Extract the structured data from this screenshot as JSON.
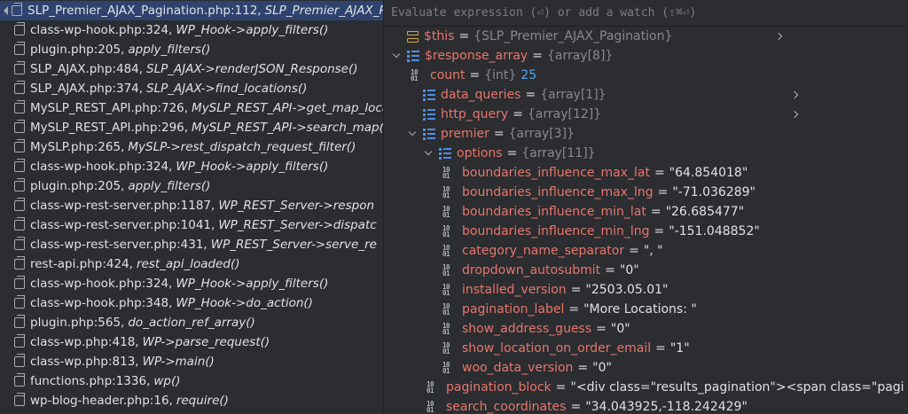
{
  "frames": [
    {
      "file": "SLP_Premier_AJAX_Pagination.php:112,",
      "method": "SLP_Premier_AJAX_P",
      "selected": true
    },
    {
      "file": "class-wp-hook.php:324,",
      "method": "WP_Hook->apply_filters()"
    },
    {
      "file": "plugin.php:205,",
      "method": "apply_filters()"
    },
    {
      "file": "SLP_AJAX.php:484,",
      "method": "SLP_AJAX->renderJSON_Response()"
    },
    {
      "file": "SLP_AJAX.php:374,",
      "method": "SLP_AJAX->find_locations()"
    },
    {
      "file": "MySLP_REST_API.php:726,",
      "method": "MySLP_REST_API->get_map_loca"
    },
    {
      "file": "MySLP_REST_API.php:296,",
      "method": "MySLP_REST_API->search_map()"
    },
    {
      "file": "MySLP.php:265,",
      "method": "MySLP->rest_dispatch_request_filter()"
    },
    {
      "file": "class-wp-hook.php:324,",
      "method": "WP_Hook->apply_filters()"
    },
    {
      "file": "plugin.php:205,",
      "method": "apply_filters()"
    },
    {
      "file": "class-wp-rest-server.php:1187,",
      "method": "WP_REST_Server->respon"
    },
    {
      "file": "class-wp-rest-server.php:1041,",
      "method": "WP_REST_Server->dispatc"
    },
    {
      "file": "class-wp-rest-server.php:431,",
      "method": "WP_REST_Server->serve_re"
    },
    {
      "file": "rest-api.php:424,",
      "method": "rest_api_loaded()"
    },
    {
      "file": "class-wp-hook.php:324,",
      "method": "WP_Hook->apply_filters()"
    },
    {
      "file": "class-wp-hook.php:348,",
      "method": "WP_Hook->do_action()"
    },
    {
      "file": "plugin.php:565,",
      "method": "do_action_ref_array()"
    },
    {
      "file": "class-wp.php:418,",
      "method": "WP->parse_request()"
    },
    {
      "file": "class-wp.php:813,",
      "method": "WP->main()"
    },
    {
      "file": "functions.php:1336,",
      "method": "wp()"
    },
    {
      "file": "wp-blog-header.php:16,",
      "method": "require()"
    }
  ],
  "evaluate": {
    "placeholder": "Evaluate expression (⏎) or add a watch (⇧⌘⏎)"
  },
  "variables": [
    {
      "name": "$this",
      "type": "{SLP_Premier_AJAX_Pagination}",
      "icon": "object-icon",
      "chevron": "right",
      "level": 0
    },
    {
      "name": "$response_array",
      "type": "{array[8]}",
      "icon": "array-icon",
      "chevron": "down",
      "level": 0
    },
    {
      "name": "count",
      "type": "{int}",
      "intval": "25",
      "icon": "primitive-icon",
      "chevron": "none",
      "level": 1
    },
    {
      "name": "data_queries",
      "type": "{array[1]}",
      "icon": "array-icon",
      "chevron": "right",
      "level": 1
    },
    {
      "name": "http_query",
      "type": "{array[12]}",
      "icon": "array-icon",
      "chevron": "right",
      "level": 1
    },
    {
      "name": "premier",
      "type": "{array[3]}",
      "icon": "array-icon",
      "chevron": "down",
      "level": 1
    },
    {
      "name": "options",
      "type": "{array[11]}",
      "icon": "array-icon",
      "chevron": "down",
      "level": 2
    },
    {
      "name": "boundaries_influence_max_lat",
      "value": "\"64.854018\"",
      "icon": "primitive-icon",
      "chevron": "none",
      "level": 3
    },
    {
      "name": "boundaries_influence_max_lng",
      "value": "\"-71.036289\"",
      "icon": "primitive-icon",
      "chevron": "none",
      "level": 3
    },
    {
      "name": "boundaries_influence_min_lat",
      "value": "\"26.685477\"",
      "icon": "primitive-icon",
      "chevron": "none",
      "level": 3
    },
    {
      "name": "boundaries_influence_min_lng",
      "value": "\"-151.048852\"",
      "icon": "primitive-icon",
      "chevron": "none",
      "level": 3
    },
    {
      "name": "category_name_separator",
      "value": "\", \"",
      "icon": "primitive-icon",
      "chevron": "none",
      "level": 3
    },
    {
      "name": "dropdown_autosubmit",
      "value": "\"0\"",
      "icon": "primitive-icon",
      "chevron": "none",
      "level": 3
    },
    {
      "name": "installed_version",
      "value": "\"2503.05.01\"",
      "icon": "primitive-icon",
      "chevron": "none",
      "level": 3
    },
    {
      "name": "pagination_label",
      "value": "\"More Locations: \"",
      "icon": "primitive-icon",
      "chevron": "none",
      "level": 3
    },
    {
      "name": "show_address_guess",
      "value": "\"0\"",
      "icon": "primitive-icon",
      "chevron": "none",
      "level": 3
    },
    {
      "name": "show_location_on_order_email",
      "value": "\"1\"",
      "icon": "primitive-icon",
      "chevron": "none",
      "level": 3
    },
    {
      "name": "woo_data_version",
      "value": "\"0\"",
      "icon": "primitive-icon",
      "chevron": "none",
      "level": 3
    },
    {
      "name": "pagination_block",
      "value": "\"<div class=\"results_pagination\"><span class=\"pagi",
      "icon": "primitive-icon",
      "chevron": "none",
      "level": 2
    },
    {
      "name": "search_coordinates",
      "value": "\"34.043925,-118.242429\"",
      "icon": "primitive-icon",
      "chevron": "none",
      "level": 2
    }
  ],
  "colors": {
    "background": "#2b2d30",
    "selection": "#2e436e",
    "var_name": "#e8766d",
    "int_value": "#58a6ef",
    "type_hint": "#868a91"
  }
}
